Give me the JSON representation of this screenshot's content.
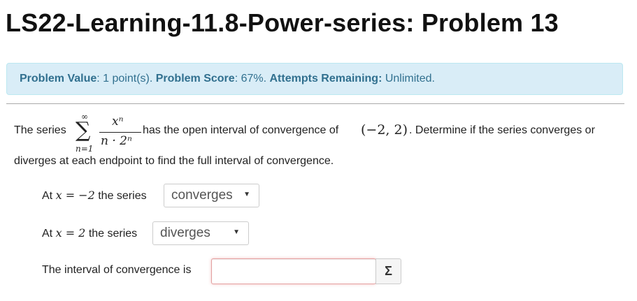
{
  "page": {
    "title": "LS22-Learning-11.8-Power-series: Problem 13"
  },
  "info_bar": {
    "problem_value_label": "Problem Value",
    "problem_value": ": 1 point(s). ",
    "problem_score_label": "Problem Score",
    "problem_score": ": 67%. ",
    "attempts_label": "Attempts Remaining:",
    "attempts_value": " Unlimited."
  },
  "problem": {
    "intro": "The series",
    "sum_upper": "∞",
    "sum_lower": "n=1",
    "sum_symbol": "∑",
    "numerator": "xⁿ",
    "denominator": "n · 2ⁿ",
    "middle": "has the open interval of convergence of",
    "interval": "(−2, 2)",
    "after_interval": ". Determine if the series converges or",
    "line2": "diverges at each endpoint to find the full interval of convergence."
  },
  "endpoint1": {
    "prefix": "At",
    "math": "x = −2",
    "suffix": "the series",
    "selected": "converges",
    "arrow": "▼"
  },
  "endpoint2": {
    "prefix": "At",
    "math": "x = 2",
    "suffix": "the series",
    "selected": "diverges",
    "arrow": "▼"
  },
  "interval_question": {
    "label": "The interval of convergence is",
    "answer_value": "",
    "equation_button": "Σ"
  },
  "colors": {
    "info_bg": "#d9edf7",
    "info_text": "#31708f",
    "input_error_border": "#e4a0a0"
  }
}
